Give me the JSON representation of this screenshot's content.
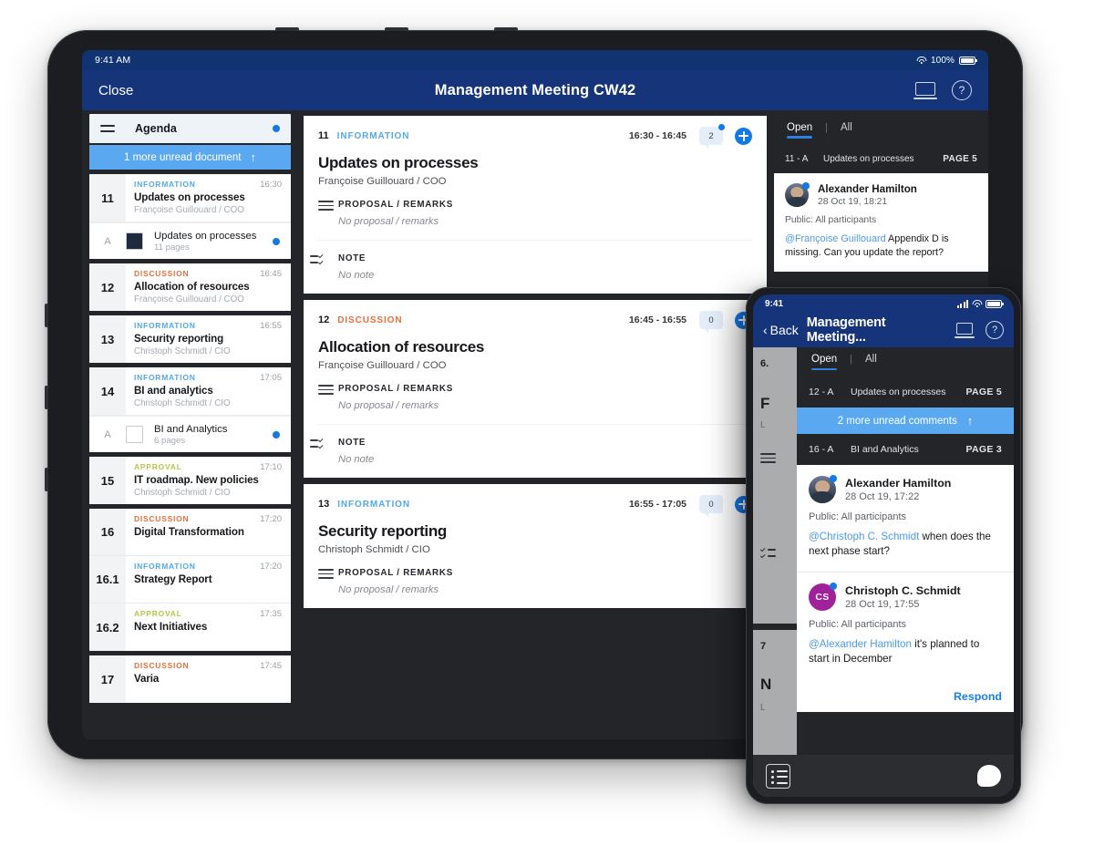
{
  "tablet": {
    "status": {
      "time": "9:41 AM",
      "battery": "100%",
      "wifi_icon": "wifi-icon",
      "battery_icon": "battery-icon"
    },
    "nav": {
      "close_label": "Close",
      "title": "Management Meeting CW42",
      "share_icon": "share-screen-icon",
      "help_icon": "help-circle-icon"
    },
    "sidebar": {
      "menu_icon": "hamburger-icon",
      "header_label": "Agenda",
      "unread_banner": {
        "label": "1 more unread document",
        "arrow": "↑"
      },
      "groups": [
        {
          "items": [
            {
              "num": "11",
              "category": "INFORMATION",
              "time": "16:30",
              "title": "Updates on processes",
              "owner": "Françoise Guillouard / COO"
            }
          ],
          "attachments": [
            {
              "code": "A",
              "thumb": "dark",
              "title": "Updates on processes",
              "pages": "11 pages",
              "unread": true
            }
          ]
        },
        {
          "items": [
            {
              "num": "12",
              "category": "DISCUSSION",
              "time": "16:45",
              "title": "Allocation of resources",
              "owner": "Françoise Guillouard / COO"
            }
          ],
          "attachments": []
        },
        {
          "items": [
            {
              "num": "13",
              "category": "INFORMATION",
              "time": "16:55",
              "title": "Security reporting",
              "owner": "Christoph Schmidt / CIO"
            }
          ],
          "attachments": []
        },
        {
          "items": [
            {
              "num": "14",
              "category": "INFORMATION",
              "time": "17:05",
              "title": "BI and analytics",
              "owner": "Christoph Schmidt / CIO"
            }
          ],
          "attachments": [
            {
              "code": "A",
              "thumb": "light",
              "title": "BI and Analytics",
              "pages": "6 pages",
              "unread": true
            }
          ]
        },
        {
          "items": [
            {
              "num": "15",
              "category": "APPROVAL",
              "time": "17:10",
              "title": "IT roadmap. New policies",
              "owner": "Christoph Schmidt / CIO"
            }
          ],
          "attachments": []
        },
        {
          "items": [
            {
              "num": "16",
              "category": "DISCUSSION",
              "time": "17:20",
              "title": "Digital Transformation",
              "owner": ""
            },
            {
              "num": "16.1",
              "category": "INFORMATION",
              "time": "17:20",
              "title": "Strategy Report",
              "owner": ""
            },
            {
              "num": "16.2",
              "category": "APPROVAL",
              "time": "17:35",
              "title": "Next Initiatives",
              "owner": ""
            }
          ],
          "attachments": []
        },
        {
          "items": [
            {
              "num": "17",
              "category": "DISCUSSION",
              "time": "17:45",
              "title": "Varia",
              "owner": ""
            }
          ],
          "attachments": []
        }
      ]
    },
    "main": {
      "cards": [
        {
          "num": "11",
          "category": "INFORMATION",
          "time_range": "16:30 - 16:45",
          "comment_count": "2",
          "has_unread": true,
          "title": "Updates on processes",
          "owner": "Françoise Guillouard / COO",
          "sections": [
            {
              "icon": "lines-icon",
              "label": "PROPOSAL / REMARKS",
              "value": "No proposal / remarks"
            },
            {
              "icon": "checklist-icon",
              "label": "NOTE",
              "value": "No note"
            }
          ]
        },
        {
          "num": "12",
          "category": "DISCUSSION",
          "time_range": "16:45 - 16:55",
          "comment_count": "0",
          "has_unread": false,
          "title": "Allocation of resources",
          "owner": "Françoise Guillouard / COO",
          "sections": [
            {
              "icon": "lines-icon",
              "label": "PROPOSAL / REMARKS",
              "value": "No proposal / remarks"
            },
            {
              "icon": "checklist-icon",
              "label": "NOTE",
              "value": "No note"
            }
          ]
        },
        {
          "num": "13",
          "category": "INFORMATION",
          "time_range": "16:55 - 17:05",
          "comment_count": "0",
          "has_unread": false,
          "title": "Security reporting",
          "owner": "Christoph Schmidt / CIO",
          "sections": [
            {
              "icon": "lines-icon",
              "label": "PROPOSAL / REMARKS",
              "value": "No proposal / remarks"
            }
          ]
        }
      ]
    },
    "comments": {
      "tabs": [
        {
          "label": "Open",
          "active": true
        },
        {
          "label": "All",
          "active": false
        }
      ],
      "separator": "|",
      "reference": {
        "code": "11 - A",
        "name": "Updates on processes",
        "page": "PAGE 5"
      },
      "entries": [
        {
          "avatar_type": "photo",
          "initials": "",
          "author": "Alexander Hamilton",
          "date": "28 Oct 19, 18:21",
          "visibility": "Public: All participants",
          "mention": "@Françoise Guillouard",
          "text": " Appendix D is missing. Can you update the report?"
        }
      ]
    },
    "bottom": {
      "list_icon": "list-view-icon"
    }
  },
  "phone": {
    "status": {
      "time": "9:41",
      "signal_icon": "cellular-signal-icon",
      "wifi_icon": "wifi-icon",
      "battery_icon": "battery-icon"
    },
    "nav": {
      "back_label": "Back",
      "title": "Management Meeting...",
      "share_icon": "share-screen-icon",
      "help_icon": "help-circle-icon"
    },
    "behind": {
      "num_top": "6.",
      "title_top": "F",
      "sub_top": "L",
      "num_bottom": "7",
      "title_bottom": "N",
      "sub_bottom": "L"
    },
    "comments": {
      "tabs": [
        {
          "label": "Open",
          "active": true
        },
        {
          "label": "All",
          "active": false
        }
      ],
      "separator": "|",
      "reference_top": {
        "code": "12 - A",
        "name": "Updates on processes",
        "page": "PAGE 5"
      },
      "unread_banner": {
        "label": "2 more unread comments",
        "arrow": "↑"
      },
      "reference_mid": {
        "code": "16 - A",
        "name": "BI and Analytics",
        "page": "PAGE 3"
      },
      "entries": [
        {
          "avatar_type": "photo",
          "initials": "",
          "author": "Alexander Hamilton",
          "date": "28 Oct 19, 17:22",
          "visibility": "Public: All participants",
          "mention": "@Christoph C. Schmidt",
          "text": " when does the next phase start?"
        },
        {
          "avatar_type": "initials",
          "initials": "CS",
          "author": "Christoph C. Schmidt",
          "date": "28 Oct 19, 17:55",
          "visibility": "Public: All participants",
          "mention": "@Alexander Hamilton",
          "text": " it's planned to start in December"
        }
      ],
      "respond_label": "Respond"
    },
    "bottom": {
      "list_icon": "list-view-icon",
      "chat_icon": "chat-bubble-icon"
    }
  },
  "colors": {
    "nav_blue": "#15347a",
    "accent_blue": "#1478e6",
    "information": "#53a9e8",
    "discussion": "#e8703a",
    "approval": "#b7c64a",
    "unread_banner": "#5aa9f0",
    "device_body": "#1b1d21"
  }
}
